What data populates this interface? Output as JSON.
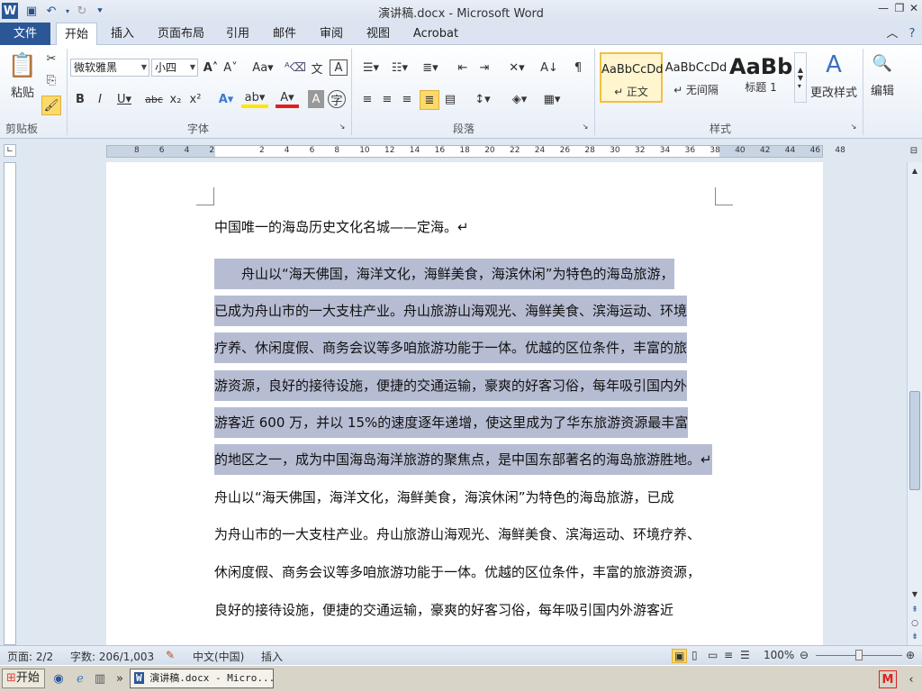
{
  "window": {
    "title": "演讲稿.docx - Microsoft Word",
    "app_icon": "W"
  },
  "tabs": {
    "file": "文件",
    "items": [
      "开始",
      "插入",
      "页面布局",
      "引用",
      "邮件",
      "审阅",
      "视图",
      "Acrobat"
    ],
    "active": "开始"
  },
  "ribbon": {
    "clipboard": {
      "paste": "粘贴",
      "group_label": "剪贴板"
    },
    "font": {
      "font_name": "微软雅黑",
      "font_size": "小四",
      "group_label": "字体"
    },
    "paragraph": {
      "group_label": "段落"
    },
    "styles": {
      "items": [
        {
          "sample": "AaBbCcDd",
          "name": "↵ 正文"
        },
        {
          "sample": "AaBbCcDd",
          "name": "↵ 无间隔"
        },
        {
          "sample": "AaBb",
          "name": "标题 1"
        }
      ],
      "group_label": "样式",
      "change_styles": "更改样式"
    },
    "editing": {
      "label": "编辑"
    }
  },
  "ruler": {
    "labels": [
      "8",
      "6",
      "4",
      "2",
      "",
      "2",
      "4",
      "6",
      "8",
      "10",
      "12",
      "14",
      "16",
      "18",
      "20",
      "22",
      "24",
      "26",
      "28",
      "30",
      "32",
      "34",
      "36",
      "38",
      "40",
      "42",
      "44",
      "46",
      "48"
    ]
  },
  "document": {
    "lines": [
      {
        "text": "中国唯一的海岛历史文化名城——定海。↵",
        "highlight": false
      },
      {
        "text": "　　舟山以“海天佛国，海洋文化，海鲜美食，海滨休闲”为特色的海岛旅游，",
        "highlight": true
      },
      {
        "text": "已成为舟山市的一大支柱产业。舟山旅游山海观光、海鲜美食、滨海运动、环境",
        "highlight": true
      },
      {
        "text": "疗养、休闲度假、商务会议等多咱旅游功能于一体。优越的区位条件，丰富的旅",
        "highlight": true
      },
      {
        "text": "游资源，良好的接待设施，便捷的交通运输，豪爽的好客习俗，每年吸引国内外",
        "highlight": true
      },
      {
        "text": "游客近 600 万，并以 15%的速度逐年递增，使这里成为了华东旅游资源最丰富",
        "highlight": true
      },
      {
        "text": "的地区之一，成为中国海岛海洋旅游的聚焦点，是中国东部著名的海岛旅游胜地。↵",
        "highlight": true
      },
      {
        "text": "舟山以“海天佛国，海洋文化，海鲜美食，海滨休闲”为特色的海岛旅游，已成",
        "highlight": false
      },
      {
        "text": "为舟山市的一大支柱产业。舟山旅游山海观光、海鲜美食、滨海运动、环境疗养、",
        "highlight": false
      },
      {
        "text": "休闲度假、商务会议等多咱旅游功能于一体。优越的区位条件，丰富的旅游资源，",
        "highlight": false
      },
      {
        "text": "良好的接待设施，便捷的交通运输，豪爽的好客习俗，每年吸引国内外游客近",
        "highlight": false
      }
    ]
  },
  "status": {
    "page": "页面: 2/2",
    "words": "字数: 206/1,003",
    "language": "中文(中国)",
    "mode": "插入",
    "zoom": "100%"
  },
  "taskbar": {
    "start": "开始",
    "task": "演讲稿.docx - Micro..."
  },
  "colors": {
    "file_tab": "#2b5797",
    "selection": "#b6bdd3"
  }
}
